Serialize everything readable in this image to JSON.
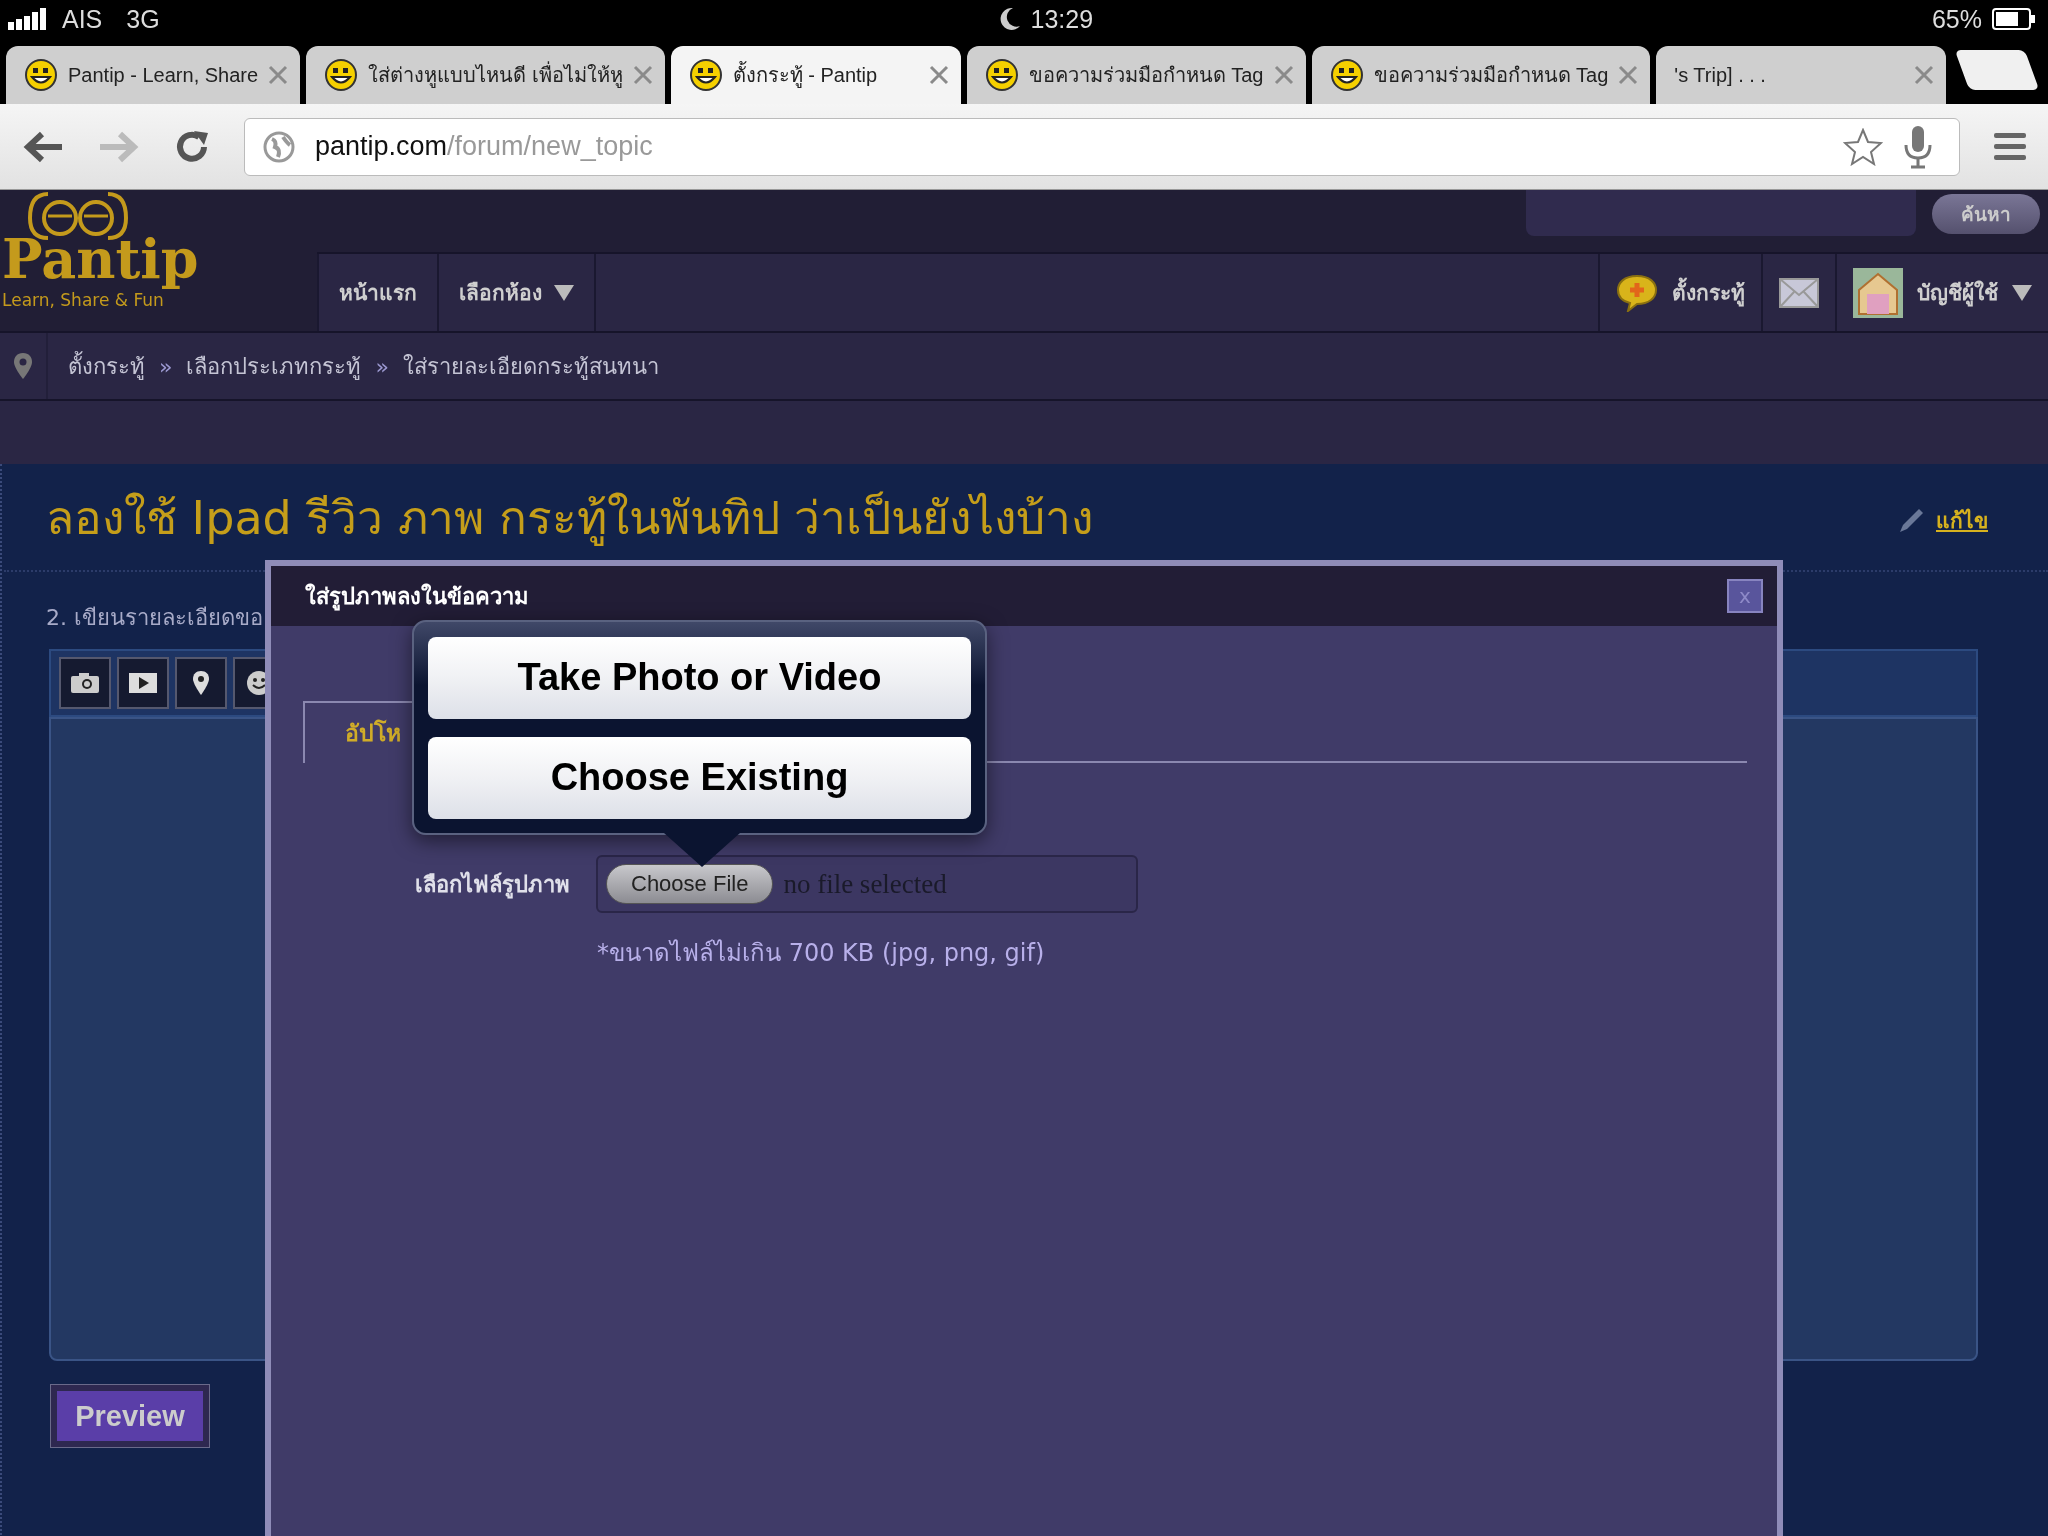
{
  "status_bar": {
    "carrier": "AIS",
    "network": "3G",
    "time": "13:29",
    "battery": "65%"
  },
  "browser": {
    "tabs": [
      {
        "title": "Pantip - Learn, Share",
        "favicon": true,
        "selected": false
      },
      {
        "title": "ใส่ต่างหูแบบไหนดี เพื่อไม่ให้หู",
        "favicon": true,
        "selected": false
      },
      {
        "title": "ตั้งกระทู้ - Pantip",
        "favicon": true,
        "selected": true
      },
      {
        "title": "ขอความร่วมมือกำหนด Tag",
        "favicon": true,
        "selected": false
      },
      {
        "title": "ขอความร่วมมือกำหนด Tag",
        "favicon": true,
        "selected": false
      },
      {
        "title": "'s Trip] . . .",
        "favicon": false,
        "selected": false
      }
    ],
    "url": {
      "host": "pantip.com",
      "path": "/forum/new_topic"
    }
  },
  "site_header": {
    "logo": {
      "name": "Pantip",
      "tagline": "Learn, Share & Fun"
    },
    "search_button": "ค้นหา",
    "nav": [
      {
        "label": "หน้าแรก",
        "dropdown": false
      },
      {
        "label": "เลือกห้อง",
        "dropdown": true
      }
    ],
    "actions": [
      {
        "kind": "new-topic",
        "label": "ตั้งกระทู้"
      },
      {
        "kind": "mail"
      },
      {
        "kind": "account",
        "label": "บัญชีผู้ใช้"
      }
    ]
  },
  "breadcrumb": {
    "separator": "»",
    "items": [
      "ตั้งกระทู้",
      "เลือกประเภทกระทู้",
      "ใส่รายละเอียดกระทู้สนทนา"
    ]
  },
  "topic": {
    "title": "ลองใช้ Ipad รีวิว ภาพ กระทู้ในพันทิป ว่าเป็นยังไงบ้าง",
    "edit_link": "แก้ไข",
    "step_label": "2. เขียนรายละเอียดขอ",
    "preview_button": "Preview"
  },
  "dialog": {
    "title": "ใส่รูปภาพลงในข้อความ",
    "close": "x",
    "tabs": [
      {
        "label": "อัปโห",
        "selected": true
      }
    ],
    "file_label": "เลือกไฟล์รูปภาพ",
    "choose_button": "Choose File",
    "file_status": "no file selected",
    "hint": "*ขนาดไฟล์ไม่เกิน 700 KB (jpg, png, gif)"
  },
  "popover": {
    "options": [
      "Take Photo or Video",
      "Choose Existing"
    ]
  }
}
